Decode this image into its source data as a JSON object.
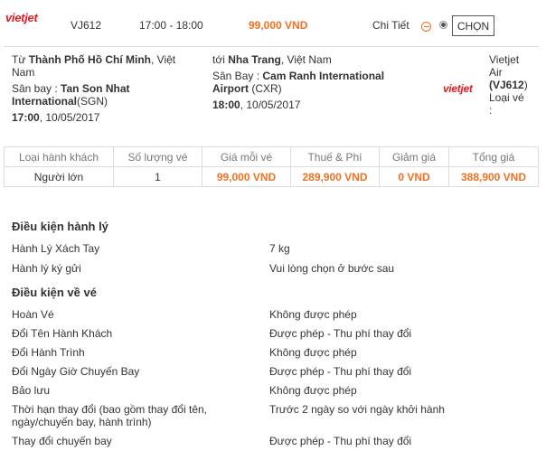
{
  "header": {
    "logo": "vietjet",
    "flight_code": "VJ612",
    "time_range": "17:00 - 18:00",
    "price": "99,000 VND",
    "detail_label": "Chi Tiết",
    "choose_label": "CHỌN"
  },
  "departure": {
    "prefix": "Từ ",
    "city": "Thành Phố Hồ Chí Minh",
    "country_a": ", Việt",
    "country_b": "Nam",
    "airport_prefix": "Sân bay : ",
    "airport_a": "Tan Son Nhat",
    "airport_b": "International",
    "airport_code": "(SGN)",
    "time": "17:00",
    "date": ", 10/05/2017"
  },
  "arrival": {
    "prefix": "tới ",
    "city": "Nha Trang",
    "country": ", Việt Nam",
    "airport_prefix": "Sân Bay : ",
    "airport_a": "Cam Ranh International",
    "airport_b": "Airport",
    "airport_code": " (CXR)",
    "time": "18:00",
    "date": ", 10/05/2017"
  },
  "carrier": {
    "logo": "vietjet",
    "name_a": "Vietjet",
    "name_b": "Air",
    "code": "(VJ612",
    "code_close": ")",
    "aircraft_label": "Loại vé",
    "aircraft_colon": ":"
  },
  "fare_table": {
    "headers": [
      "Loại hành khách",
      "Số lượng vé",
      "Giá mỗi vé",
      "Thuế & Phí",
      "Giảm giá",
      "Tổng giá"
    ],
    "rows": [
      [
        "Người lớn",
        "1",
        "99,000 VND",
        "289,900 VND",
        "0 VND",
        "388,900 VND"
      ]
    ]
  },
  "baggage": {
    "title": "Điều kiện hành lý",
    "rows": [
      {
        "label": "Hành Lý Xách Tay",
        "value": "7 kg"
      },
      {
        "label": "Hành lý ký gửi",
        "value": "Vui lòng chọn ở bước sau"
      }
    ]
  },
  "ticket_conditions": {
    "title": "Điều kiện về vé",
    "rows": [
      {
        "label": "Hoàn Vé",
        "value": "Không được phép"
      },
      {
        "label": "Đổi Tên Hành Khách",
        "value": "Được phép - Thu phí thay đổi"
      },
      {
        "label": "Đổi Hành Trình",
        "value": "Không được phép"
      },
      {
        "label": "Đổi Ngày Giờ Chuyến Bay",
        "value": "Được phép - Thu phí thay đổi"
      },
      {
        "label": "Bảo lưu",
        "value": "Không được phép"
      },
      {
        "label": "Thời hạn thay đổi (bao gồm thay đổi tên,",
        "label_b": "ngày/chuyến bay, hành trình)",
        "value": "Trước 2 ngày so với ngày khởi hành"
      },
      {
        "label": "Thay đổi chuyến bay",
        "value": "Được phép - Thu phí thay đổi"
      }
    ]
  }
}
